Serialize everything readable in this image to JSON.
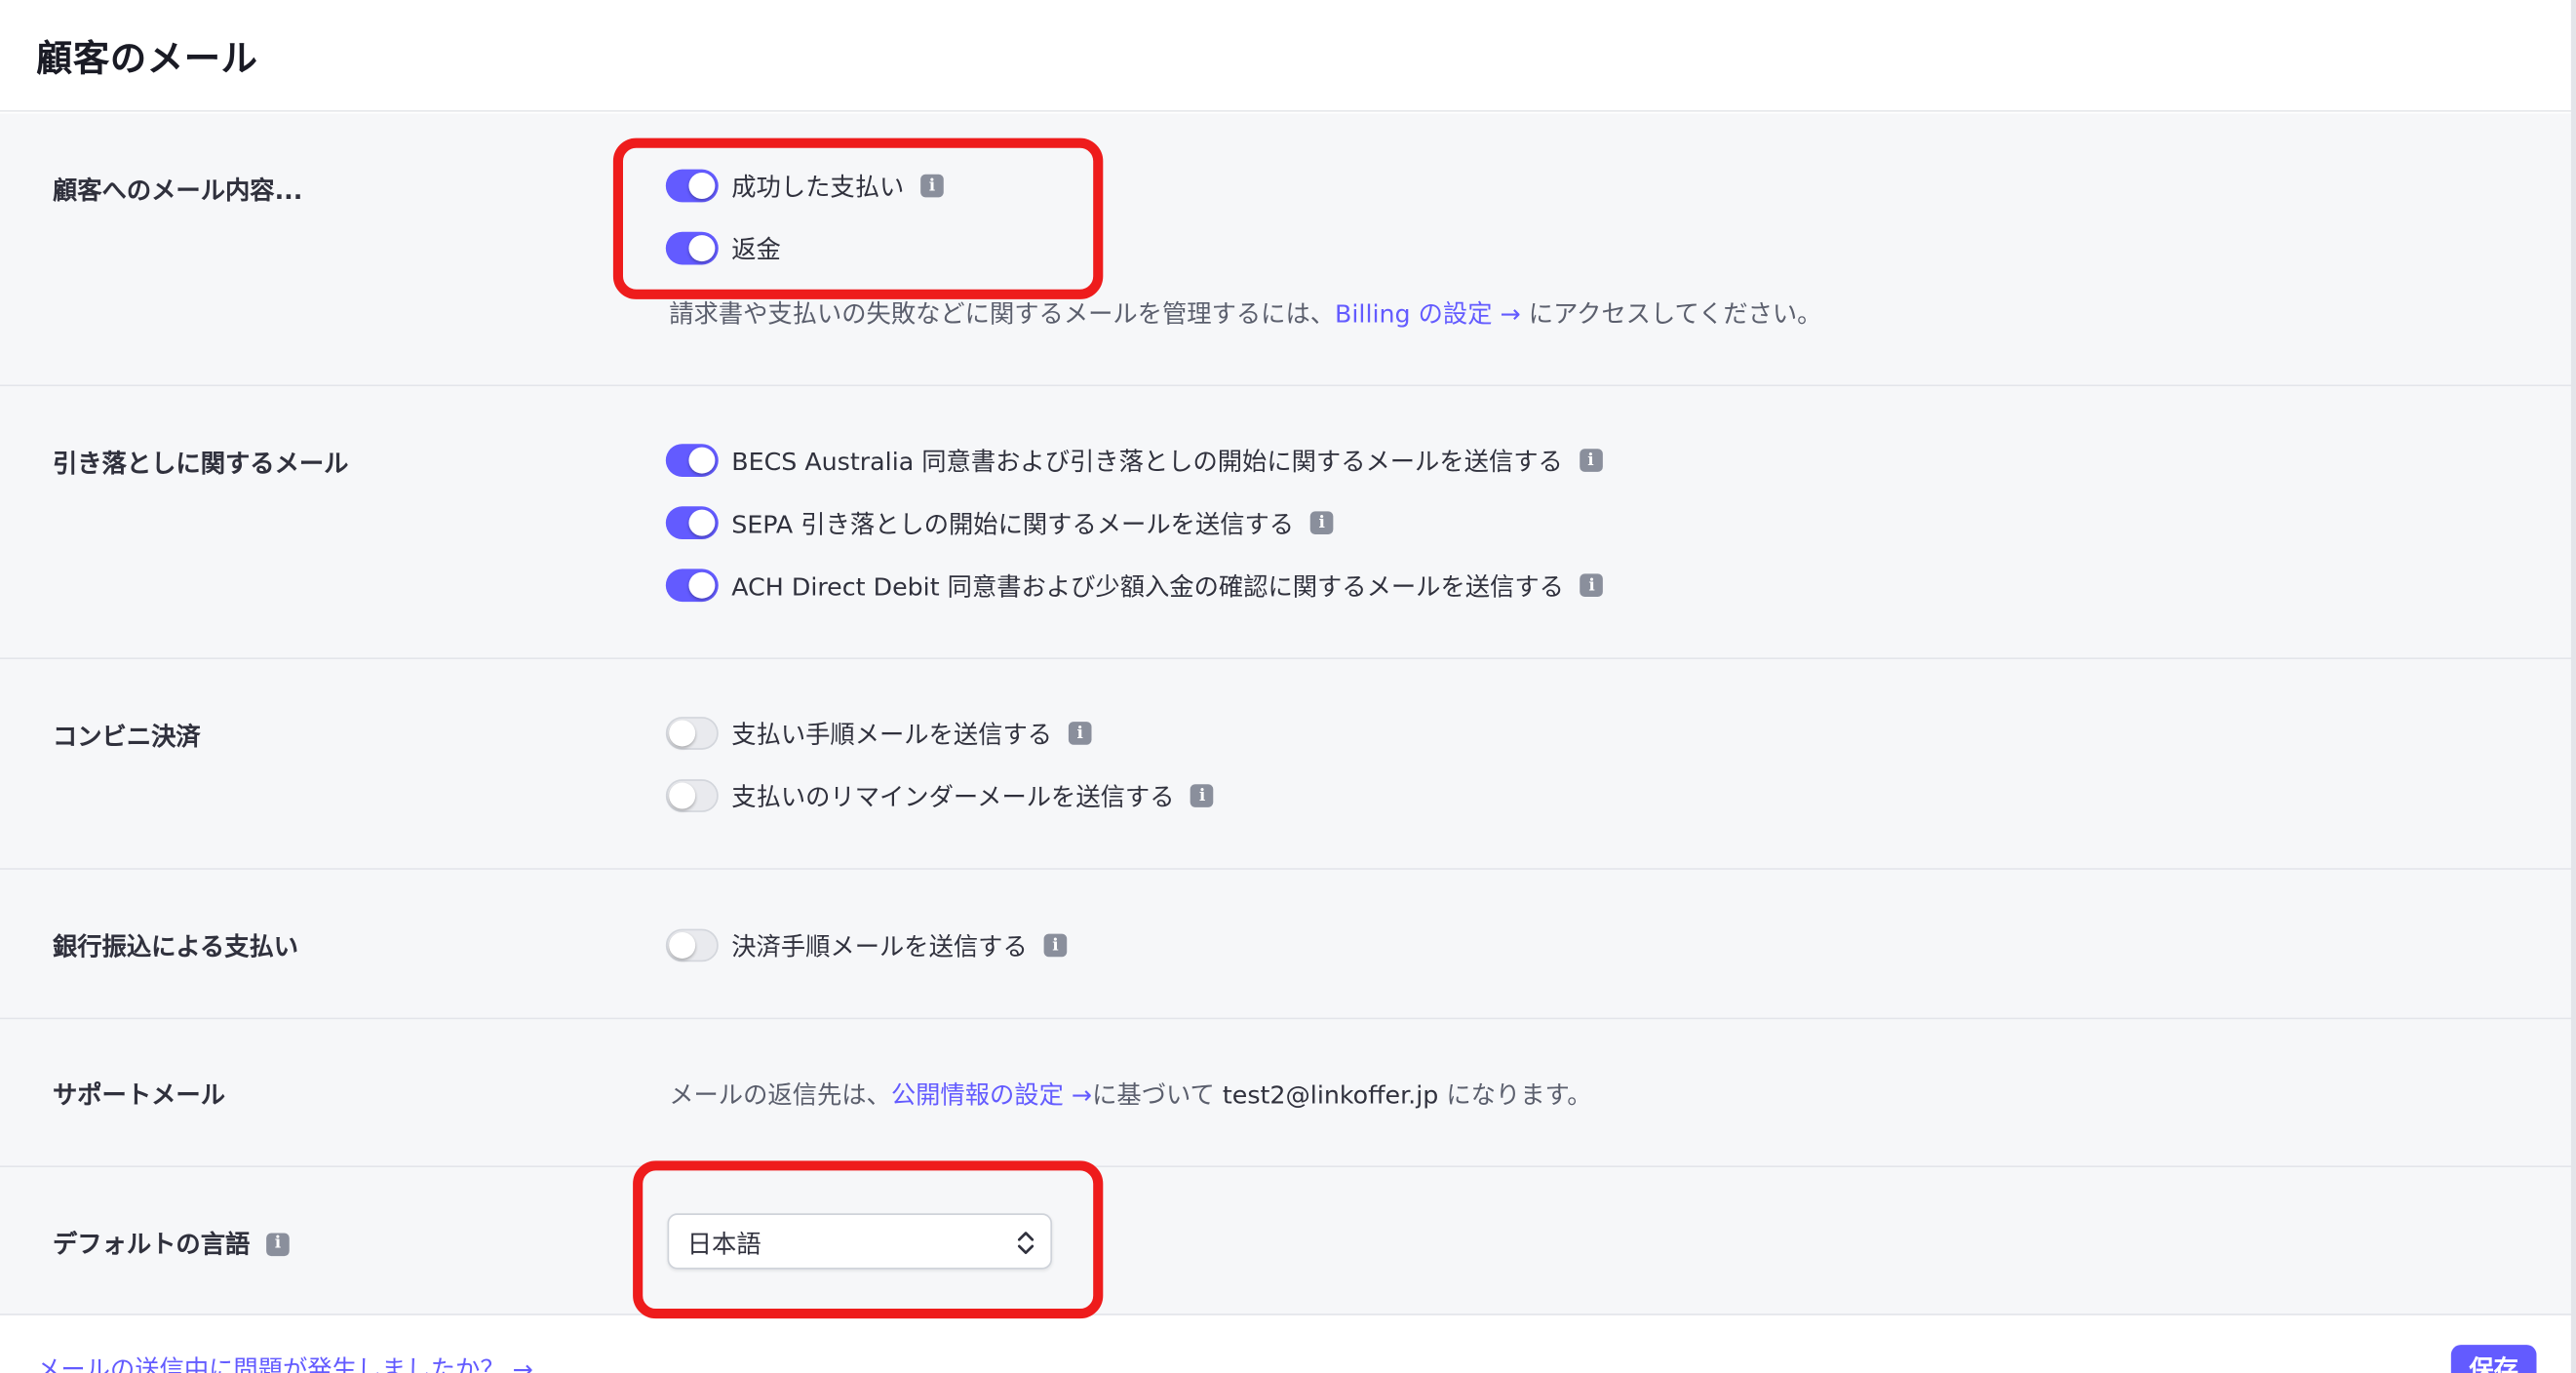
{
  "page": {
    "title": "顧客のメール"
  },
  "sections": {
    "customer_email": {
      "label": "顧客へのメール内容...",
      "items": [
        {
          "label": "成功した支払い",
          "enabled": true
        },
        {
          "label": "返金",
          "enabled": true
        }
      ],
      "note_before": "請求書や支払いの失敗などに関するメールを管理するには、",
      "note_link": "Billing の設定 →",
      "note_after": " にアクセスしてください。"
    },
    "debit": {
      "label": "引き落としに関するメール",
      "items": [
        {
          "label": "BECS Australia 同意書および引き落としの開始に関するメールを送信する",
          "enabled": true
        },
        {
          "label": "SEPA 引き落としの開始に関するメールを送信する",
          "enabled": true
        },
        {
          "label": "ACH Direct Debit 同意書および少額入金の確認に関するメールを送信する",
          "enabled": true
        }
      ]
    },
    "konbini": {
      "label": "コンビニ決済",
      "items": [
        {
          "label": "支払い手順メールを送信する",
          "enabled": false
        },
        {
          "label": "支払いのリマインダーメールを送信する",
          "enabled": false
        }
      ]
    },
    "bank_transfer": {
      "label": "銀行振込による支払い",
      "items": [
        {
          "label": "決済手順メールを送信する",
          "enabled": false
        }
      ]
    },
    "support": {
      "label": "サポートメール",
      "text_before": "メールの返信先は、",
      "link": "公開情報の設定 →",
      "text_middle": "に基づいて ",
      "email": "test2@linkoffer.jp",
      "text_after": " になります。"
    },
    "language": {
      "label": "デフォルトの言語",
      "selected": "日本語"
    }
  },
  "footer": {
    "help_link": "メールの送信中に問題が発生しましたか？ →",
    "save_label": "保存"
  },
  "colors": {
    "accent": "#635bff",
    "highlight": "#ee1c1c",
    "section_bg": "#f6f7f9"
  },
  "icons": {
    "info": "info-icon",
    "select_chevron": "chevron-up-down-icon"
  }
}
